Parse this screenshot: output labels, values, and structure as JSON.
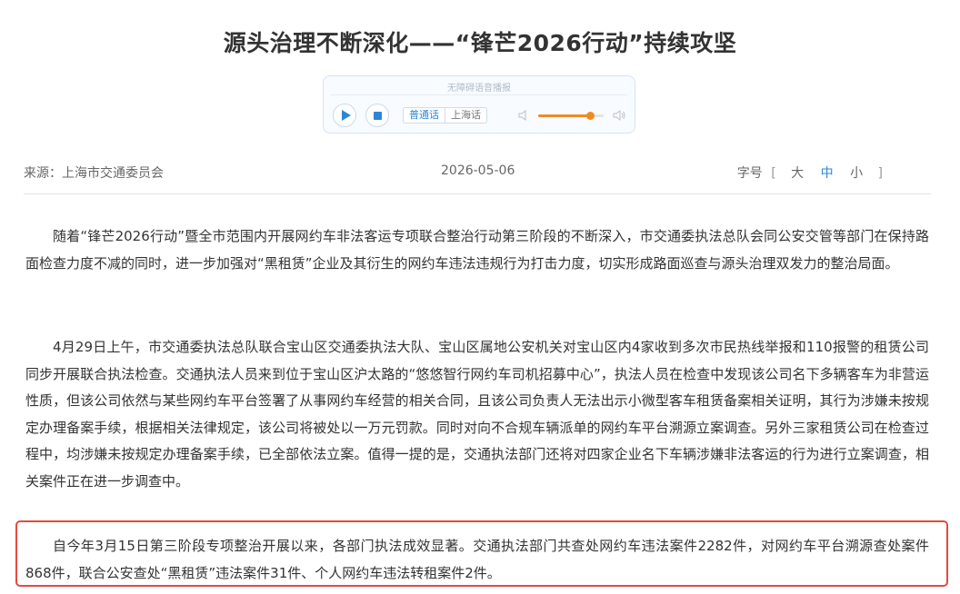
{
  "article": {
    "title": "源头治理不断深化——“锋芒2026行动”持续攻坚",
    "source": "来源：上海市交通委员会",
    "date": "2026-05-06",
    "paragraphs": [
      "随着“锋芒2026行动”暨全市范围内开展网约车非法客运专项联合整治行动第三阶段的不断深入，市交通委执法总队会同公安交管等部门在保持路面检查力度不减的同时，进一步加强对“黑租赁”企业及其衍生的网约车违法违规行为打击力度，切实形成路面巡查与源头治理双发力的整治局面。",
      "4月29日上午，市交通委执法总队联合宝山区交通委执法大队、宝山区属地公安机关对宝山区内4家收到多次市民热线举报和110报警的租赁公司同步开展联合执法检查。交通执法人员来到位于宝山区沪太路的“悠悠智行网约车司机招募中心”，执法人员在检查中发现该公司名下多辆客车为非营运性质，但该公司依然与某些网约车平台签署了从事网约车经营的相关合同，且该公司负责人无法出示小微型客车租赁备案相关证明，其行为涉嫌未按规定办理备案手续，根据相关法律规定，该公司将被处以一万元罚款。同时对向不合规车辆派单的网约车平台溯源立案调查。另外三家租赁公司在检查过程中，均涉嫌未按规定办理备案手续，已全部依法立案。值得一提的是，交通执法部门还将对四家企业名下车辆涉嫌非法客运的行为进行立案调查，相关案件正在进一步调查中。",
      "自今年3月15日第三阶段专项整治开展以来，各部门执法成效显著。交通执法部门共查处网约车违法案件2282件，对网约车平台溯源查处案件868件，联合公安查处“黑租赁”违法案件31件、个人网约车违法转租案件2件。"
    ]
  },
  "player": {
    "label": "无障碍语音播报",
    "lang_options": [
      "普通话",
      "上海话"
    ],
    "selected_lang": "普通话",
    "volume": 0.8,
    "icons": [
      "play-icon",
      "stop-icon",
      "volume-low-icon",
      "volume-high-icon"
    ],
    "accent_color": "#2f86d8",
    "slider_color": "#f08a24"
  },
  "font_size_control": {
    "label": "字号",
    "bracket_open": "[",
    "bracket_close": "]",
    "options": [
      "大",
      "中",
      "小"
    ],
    "selected": "中"
  },
  "highlight_color": "#e34a3e"
}
